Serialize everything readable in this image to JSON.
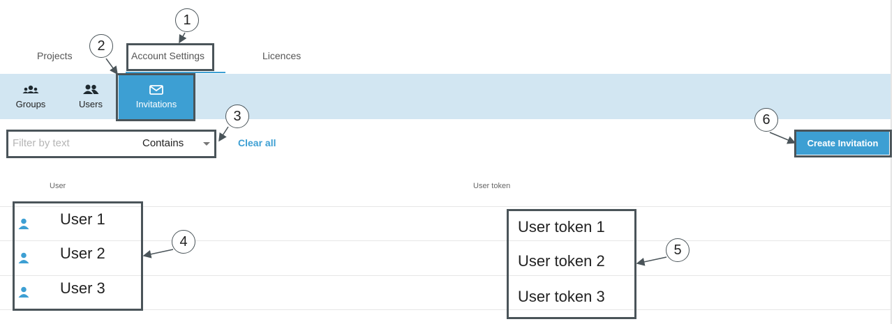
{
  "top_tabs": [
    {
      "label": "Projects"
    },
    {
      "label": "Account Settings"
    },
    {
      "label": "Licences"
    }
  ],
  "sub_nav": [
    {
      "label": "Groups",
      "icon": "groups-icon"
    },
    {
      "label": "Users",
      "icon": "users-icon"
    },
    {
      "label": "Invitations",
      "icon": "envelope-icon",
      "active": true
    }
  ],
  "filter": {
    "placeholder": "Filter by text",
    "operator": "Contains",
    "clear_label": "Clear all"
  },
  "create_button": "Create Invitation",
  "table": {
    "columns": [
      "User",
      "User token"
    ],
    "rows": [
      {
        "user": "User 1",
        "token": "User token 1"
      },
      {
        "user": "User 2",
        "token": "User token 2"
      },
      {
        "user": "User 3",
        "token": "User token 3"
      }
    ]
  },
  "annotations": [
    "1",
    "2",
    "3",
    "4",
    "5",
    "6"
  ],
  "colors": {
    "accent": "#3d9fd3",
    "subnav_background": "#d2e6f2",
    "annotation_border": "#4a5459"
  }
}
